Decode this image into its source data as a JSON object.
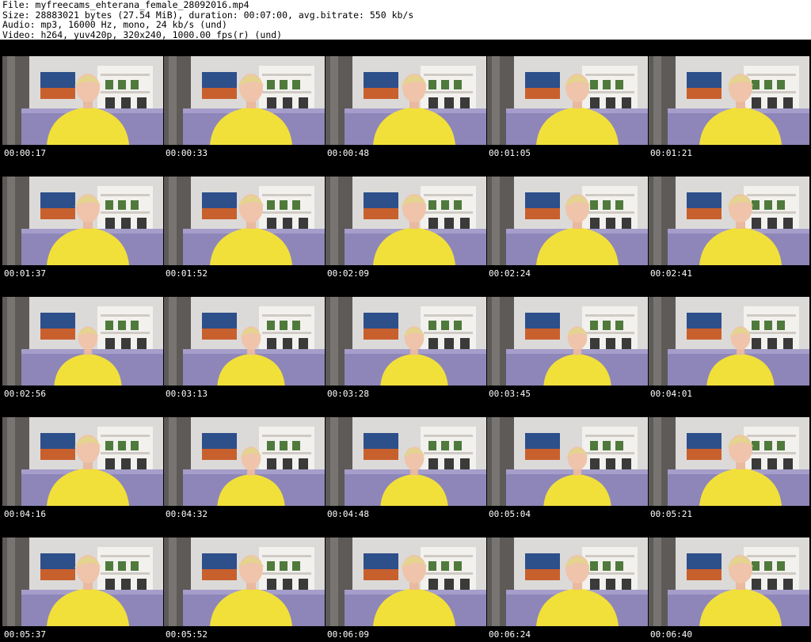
{
  "header": {
    "file_line": "File: myfreecams_ehterana_female_28092016.mp4",
    "size_line": "Size: 28883021 bytes (27.54 MiB), duration: 00:07:00, avg.bitrate: 550 kb/s",
    "audio_line": "Audio: mp3, 16000 Hz, mono, 24 kb/s (und)",
    "video_line": "Video: h264, yuv420p, 320x240, 1000.00 fps(r) (und)"
  },
  "colors": {
    "background": "#ffffff",
    "sheet": "#000000",
    "timestamp_text": "#ffffff",
    "shirt": "#f2e03a",
    "sofa": "#8e86b8",
    "wall": "#dcdad8",
    "hair": "#e4d48e"
  },
  "thumbnails": [
    {
      "time": "00:00:17"
    },
    {
      "time": "00:00:33"
    },
    {
      "time": "00:00:48"
    },
    {
      "time": "00:01:05"
    },
    {
      "time": "00:01:21"
    },
    {
      "time": "00:01:37"
    },
    {
      "time": "00:01:52"
    },
    {
      "time": "00:02:09"
    },
    {
      "time": "00:02:24"
    },
    {
      "time": "00:02:41"
    },
    {
      "time": "00:02:56"
    },
    {
      "time": "00:03:13"
    },
    {
      "time": "00:03:28"
    },
    {
      "time": "00:03:45"
    },
    {
      "time": "00:04:01"
    },
    {
      "time": "00:04:16"
    },
    {
      "time": "00:04:32"
    },
    {
      "time": "00:04:48"
    },
    {
      "time": "00:05:04"
    },
    {
      "time": "00:05:21"
    },
    {
      "time": "00:05:37"
    },
    {
      "time": "00:05:52"
    },
    {
      "time": "00:06:09"
    },
    {
      "time": "00:06:24"
    },
    {
      "time": "00:06:40"
    }
  ]
}
